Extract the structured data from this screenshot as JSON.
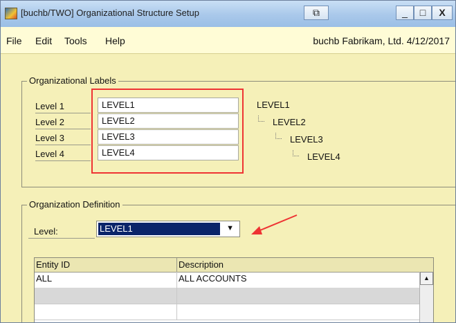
{
  "window": {
    "title": "[buchb/TWO] Organizational Structure Setup",
    "controls": {
      "extra": "⧉",
      "minimize": "_",
      "maximize": "□",
      "close": "X"
    }
  },
  "menu": {
    "items": [
      "File",
      "Edit",
      "Tools",
      "Help"
    ],
    "status": "buchb  Fabrikam, Ltd.  4/12/2017"
  },
  "labels_group": {
    "title": "Organizational Labels",
    "rows": [
      {
        "label": "Level 1",
        "value": "LEVEL1"
      },
      {
        "label": "Level 2",
        "value": "LEVEL2"
      },
      {
        "label": "Level 3",
        "value": "LEVEL3"
      },
      {
        "label": "Level 4",
        "value": "LEVEL4"
      }
    ],
    "tree": [
      "LEVEL1",
      "LEVEL2",
      "LEVEL3",
      "LEVEL4"
    ]
  },
  "definition_group": {
    "title": "Organization Definition",
    "level_label": "Level:",
    "level_value": "LEVEL1",
    "columns": [
      "Entity ID",
      "Description"
    ],
    "rows": [
      {
        "entity_id": "ALL",
        "description": "ALL ACCOUNTS"
      },
      {
        "entity_id": "",
        "description": ""
      },
      {
        "entity_id": "",
        "description": ""
      }
    ]
  },
  "colors": {
    "background": "#f5f0b8",
    "highlight": "#e33333",
    "selection": "#0a246a"
  }
}
